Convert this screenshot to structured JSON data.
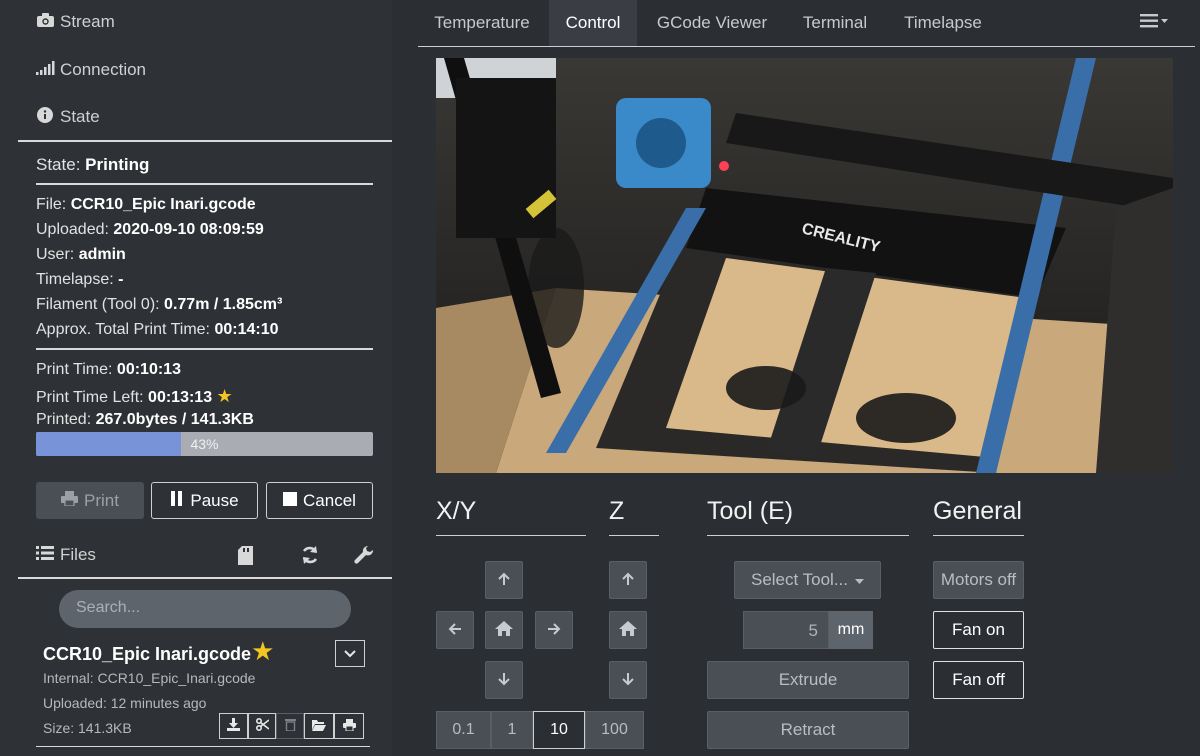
{
  "sidebar": {
    "stream_label": "Stream",
    "connection_label": "Connection",
    "state_label": "State",
    "state": {
      "state_key": "State:",
      "state_value": "Printing",
      "file_key": "File:",
      "file_value": "CCR10_Epic Inari.gcode",
      "uploaded_key": "Uploaded:",
      "uploaded_value": "2020-09-10 08:09:59",
      "user_key": "User:",
      "user_value": "admin",
      "timelapse_key": "Timelapse:",
      "timelapse_value": "-",
      "filament_key": "Filament (Tool 0):",
      "filament_value": "0.77m / 1.85cm³",
      "approx_key": "Approx. Total Print Time:",
      "approx_value": "00:14:10",
      "print_time_key": "Print Time:",
      "print_time_value": "00:10:13",
      "time_left_key": "Print Time Left:",
      "time_left_value": "00:13:13",
      "printed_key": "Printed:",
      "printed_value": "267.0bytes / 141.3KB",
      "progress_percent": 43,
      "progress_label": "43%"
    },
    "buttons": {
      "print": "Print",
      "pause": "Pause",
      "cancel": "Cancel"
    },
    "files": {
      "label": "Files",
      "search_placeholder": "Search...",
      "item": {
        "name": "CCR10_Epic Inari.gcode",
        "internal": "Internal: CCR10_Epic_Inari.gcode",
        "uploaded": "Uploaded: 12 minutes ago",
        "size": "Size: 141.3KB"
      }
    }
  },
  "tabs": [
    {
      "label": "Temperature"
    },
    {
      "label": "Control"
    },
    {
      "label": "GCode Viewer"
    },
    {
      "label": "Terminal"
    },
    {
      "label": "Timelapse"
    }
  ],
  "active_tab": "Control",
  "webcam": {
    "brand_text": "CREALITY"
  },
  "control": {
    "xy_title": "X/Y",
    "z_title": "Z",
    "tool_title": "Tool (E)",
    "general_title": "General",
    "steps": [
      "0.1",
      "1",
      "10",
      "100"
    ],
    "active_step": "10",
    "select_tool": "Select Tool...",
    "extrude_amount": "5",
    "extrude_unit": "mm",
    "extrude": "Extrude",
    "retract": "Retract",
    "motors_off": "Motors off",
    "fan_on": "Fan on",
    "fan_off": "Fan off"
  },
  "colors": {
    "background": "#2b2e33",
    "progress_fill": "#7893d8",
    "star": "#f3c623"
  }
}
